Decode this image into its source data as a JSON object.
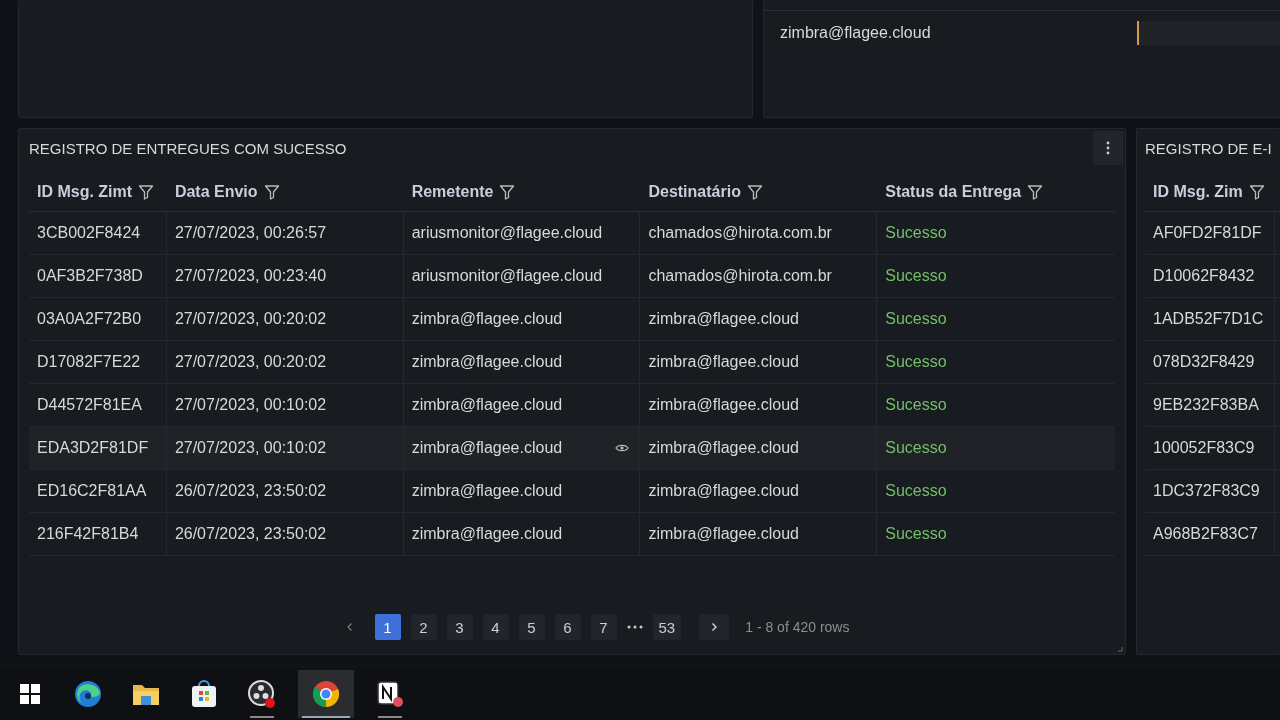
{
  "top_right_panel": {
    "rows": [
      {
        "label": "zimbra@flagee.cloud"
      }
    ]
  },
  "main_panel": {
    "title": "REGISTRO DE ENTREGUES COM SUCESSO",
    "columns": [
      {
        "label": "ID Msg. Zimt",
        "kind": "text"
      },
      {
        "label": "Data Envio",
        "kind": "text"
      },
      {
        "label": "Remetente",
        "kind": "text"
      },
      {
        "label": "Destinatário",
        "kind": "text"
      },
      {
        "label": "Status da Entrega",
        "kind": "status"
      }
    ],
    "rows": [
      {
        "cells": [
          "3CB002F8424",
          "27/07/2023, 00:26:57",
          "ariusmonitor@flagee.cloud",
          "chamados@hirota.com.br",
          "Sucesso"
        ],
        "hovered": false
      },
      {
        "cells": [
          "0AF3B2F738D",
          "27/07/2023, 00:23:40",
          "ariusmonitor@flagee.cloud",
          "chamados@hirota.com.br",
          "Sucesso"
        ],
        "hovered": false
      },
      {
        "cells": [
          "03A0A2F72B0",
          "27/07/2023, 00:20:02",
          "zimbra@flagee.cloud",
          "zimbra@flagee.cloud",
          "Sucesso"
        ],
        "hovered": false
      },
      {
        "cells": [
          "D17082F7E22",
          "27/07/2023, 00:20:02",
          "zimbra@flagee.cloud",
          "zimbra@flagee.cloud",
          "Sucesso"
        ],
        "hovered": false
      },
      {
        "cells": [
          "D44572F81EA",
          "27/07/2023, 00:10:02",
          "zimbra@flagee.cloud",
          "zimbra@flagee.cloud",
          "Sucesso"
        ],
        "hovered": false
      },
      {
        "cells": [
          "EDA3D2F81DF",
          "27/07/2023, 00:10:02",
          "zimbra@flagee.cloud",
          "zimbra@flagee.cloud",
          "Sucesso"
        ],
        "hovered": true
      },
      {
        "cells": [
          "ED16C2F81AA",
          "26/07/2023, 23:50:02",
          "zimbra@flagee.cloud",
          "zimbra@flagee.cloud",
          "Sucesso"
        ],
        "hovered": false
      },
      {
        "cells": [
          "216F42F81B4",
          "26/07/2023, 23:50:02",
          "zimbra@flagee.cloud",
          "zimbra@flagee.cloud",
          "Sucesso"
        ],
        "hovered": false
      }
    ],
    "pagination": {
      "pages": [
        {
          "label": "1",
          "selected": true
        },
        {
          "label": "2",
          "selected": false
        },
        {
          "label": "3",
          "selected": false
        },
        {
          "label": "4",
          "selected": false
        },
        {
          "label": "5",
          "selected": false
        },
        {
          "label": "6",
          "selected": false
        },
        {
          "label": "7",
          "selected": false
        },
        {
          "label": "53",
          "selected": false
        }
      ],
      "summary": "1 - 8 of 420 rows"
    }
  },
  "side_panel": {
    "title": "REGISTRO DE E-I",
    "column": "ID Msg. Zim",
    "rows": [
      "AF0FD2F81DF",
      "D10062F8432",
      "1ADB52F7D1C",
      "078D32F8429",
      "9EB232F83BA",
      "100052F83C9",
      "1DC372F83C9",
      "A968B2F83C7"
    ]
  },
  "taskbar": {
    "apps": [
      {
        "kind": "start",
        "active": false,
        "running": false
      },
      {
        "kind": "edge",
        "active": false,
        "running": false
      },
      {
        "kind": "files",
        "active": false,
        "running": false
      },
      {
        "kind": "store",
        "active": false,
        "running": false
      },
      {
        "kind": "obs",
        "active": false,
        "running": true
      },
      {
        "kind": "chrome",
        "active": true,
        "running": true
      },
      {
        "kind": "notion",
        "active": false,
        "running": true
      }
    ]
  }
}
